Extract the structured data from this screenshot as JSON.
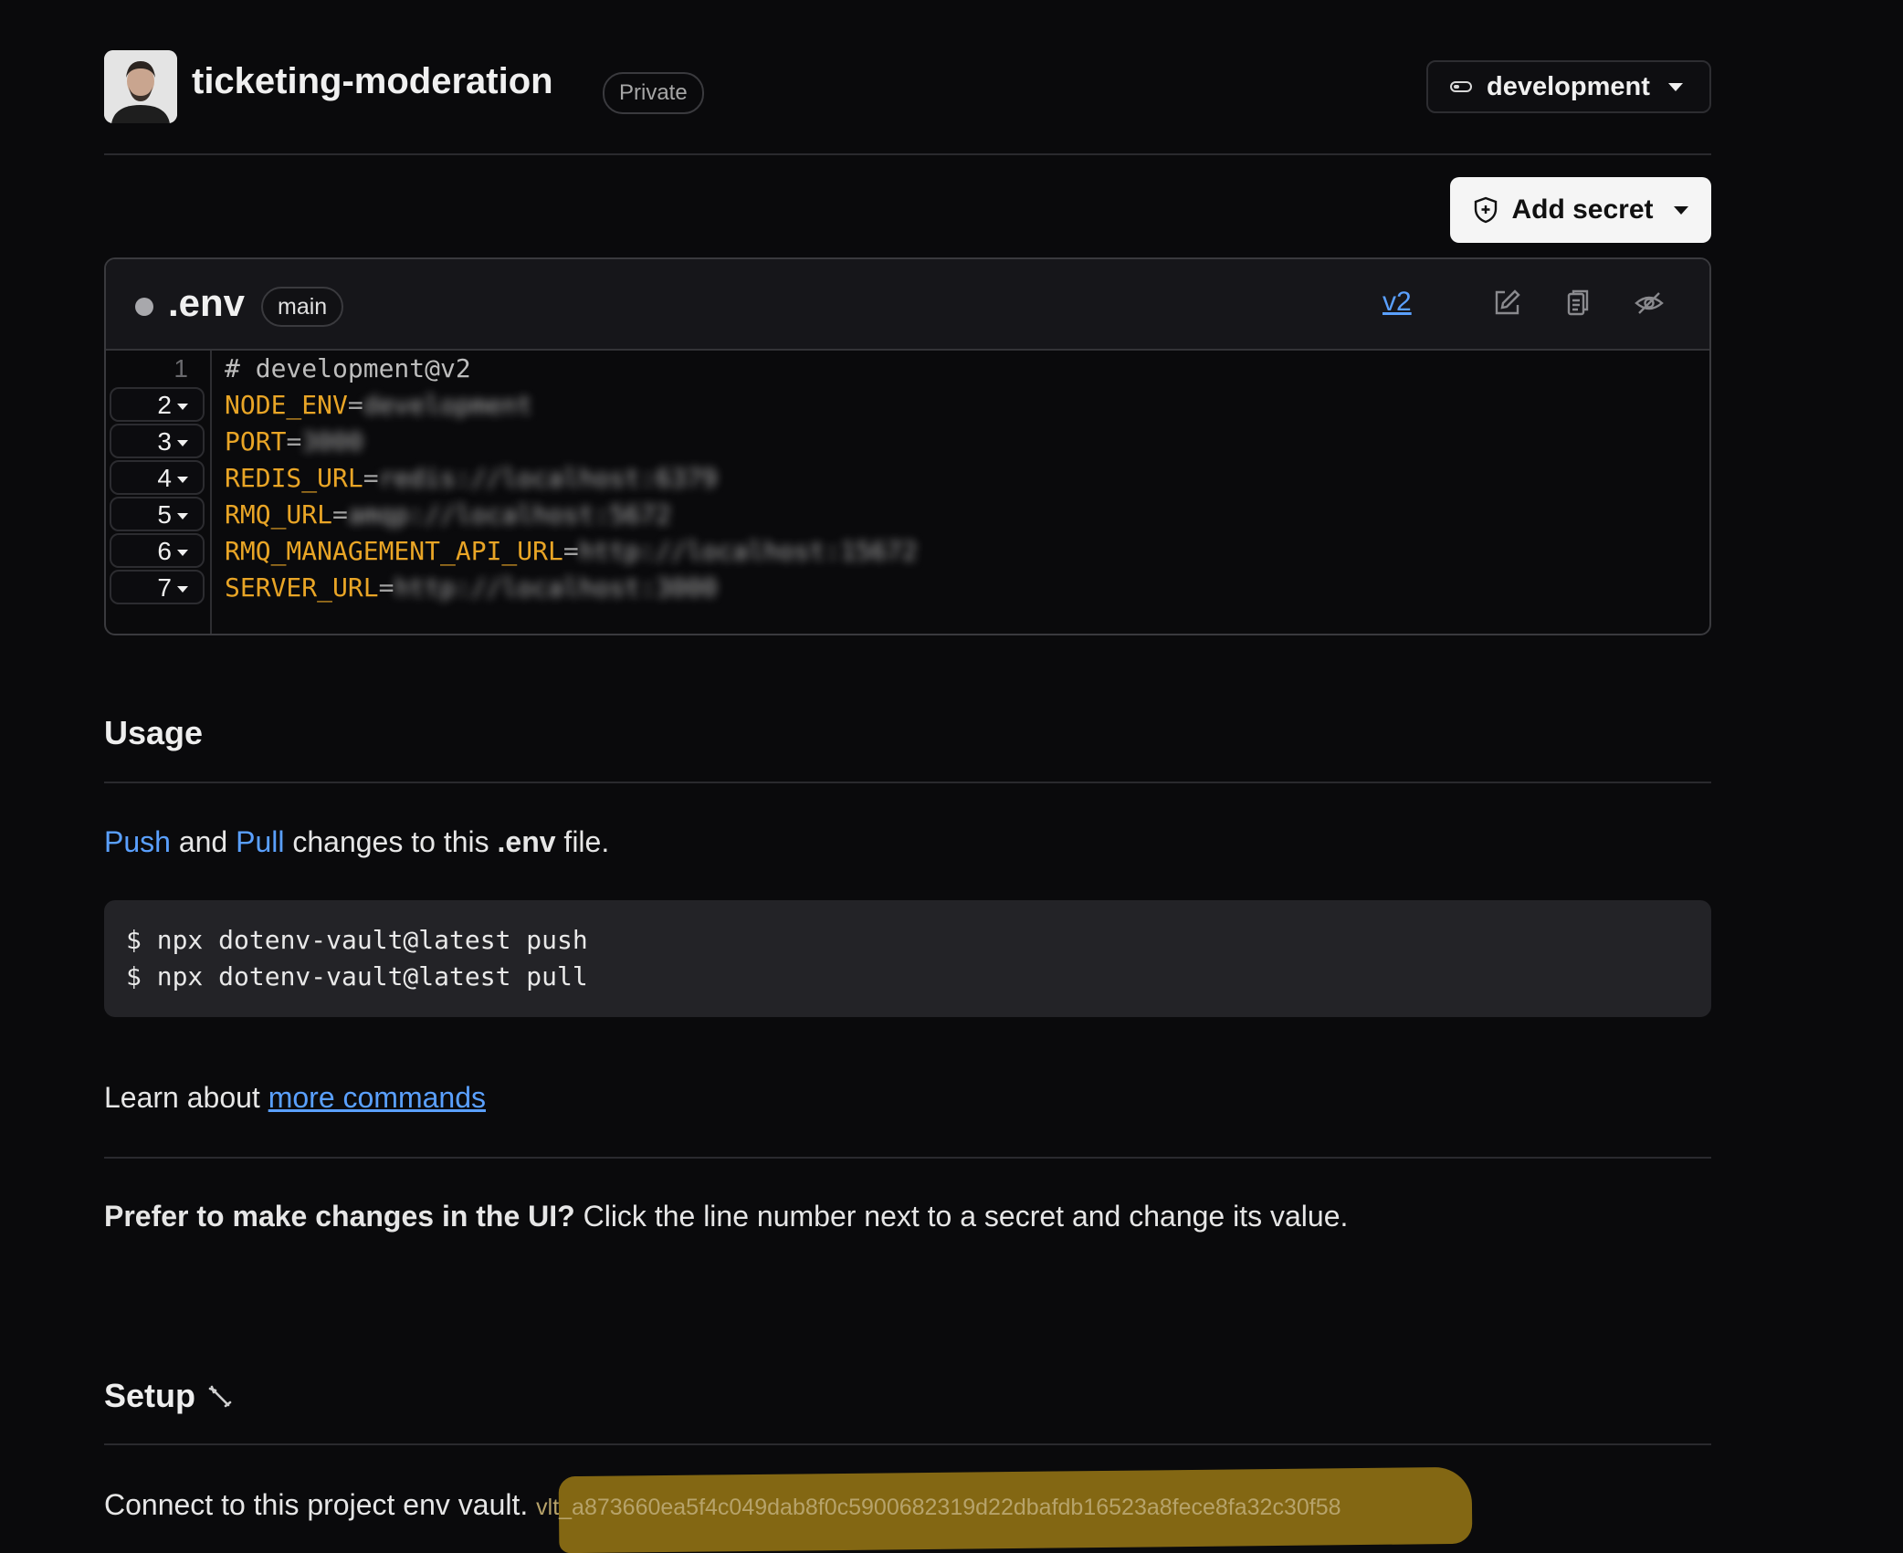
{
  "project": {
    "name": "ticketing-moderation",
    "visibility": "Private"
  },
  "environment_selector": {
    "value": "development"
  },
  "add_secret_button": {
    "label": "Add secret"
  },
  "env_file": {
    "name": ".env",
    "branch": "main",
    "version": "v2",
    "lines": [
      {
        "num": "1",
        "comment": "# development@v2"
      },
      {
        "num": "2",
        "key": "NODE_ENV",
        "value": "development"
      },
      {
        "num": "3",
        "key": "PORT",
        "value": "3000"
      },
      {
        "num": "4",
        "key": "REDIS_URL",
        "value": "redis://localhost:6379"
      },
      {
        "num": "5",
        "key": "RMQ_URL",
        "value": "amqp://localhost:5672"
      },
      {
        "num": "6",
        "key": "RMQ_MANAGEMENT_API_URL",
        "value": "http://localhost:15672"
      },
      {
        "num": "7",
        "key": "SERVER_URL",
        "value": "http://localhost:3000"
      }
    ]
  },
  "usage": {
    "title": "Usage",
    "push_link": "Push",
    "and_text": "and",
    "pull_link": "Pull",
    "desc_middle": "changes to this",
    "desc_file": ".env",
    "desc_end": "file.",
    "commands": [
      "$ npx dotenv-vault@latest push",
      "$ npx dotenv-vault@latest pull"
    ],
    "learn_prefix": "Learn about",
    "learn_link": "more commands",
    "tip_bold": "Prefer to make changes in the UI?",
    "tip_text": "Click the line number next to a secret and change its value."
  },
  "setup": {
    "title": "Setup",
    "connect_text": "Connect to this project env vault.",
    "vault_key": "vlt_a873660ea5f4c049dab8f0c5900682319d22dbafdb16523a8fece8fa32c30f58"
  },
  "colors": {
    "accent_link": "#5aa0ff",
    "env_key": "#e9a526",
    "highlight": "#8a6d14"
  }
}
